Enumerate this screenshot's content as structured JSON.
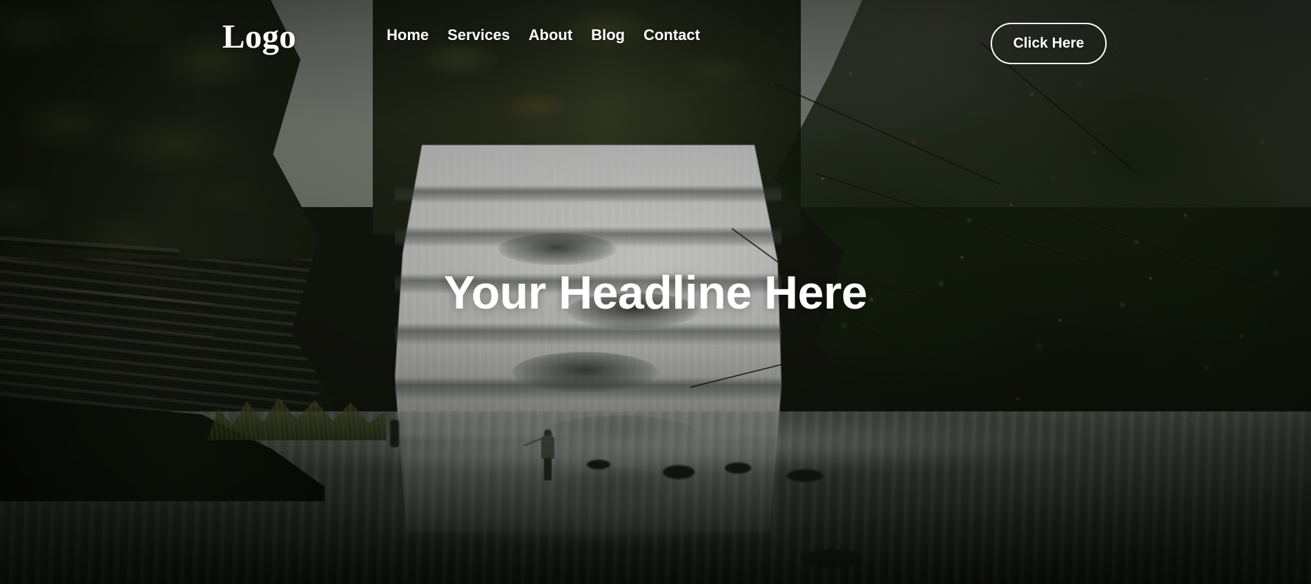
{
  "page": {
    "type": "hero-landing-page",
    "background_description": "waterfall-forest-photo"
  },
  "navbar": {
    "logo": "Logo",
    "links": [
      {
        "label": "Home"
      },
      {
        "label": "Services"
      },
      {
        "label": "About"
      },
      {
        "label": "Blog"
      },
      {
        "label": "Contact"
      }
    ],
    "cta": {
      "label": "Click Here"
    }
  },
  "hero": {
    "headline": "Your Headline Here"
  },
  "colors": {
    "text": "#ffffff",
    "cta_border": "#ffffff",
    "cta_fill": "transparent",
    "sky": "#aeb2aa",
    "foliage_green": "#2c441c",
    "foliage_autumn": "#a8601c",
    "water_white": "#e3e3e2",
    "river_dark": "#33382f"
  }
}
